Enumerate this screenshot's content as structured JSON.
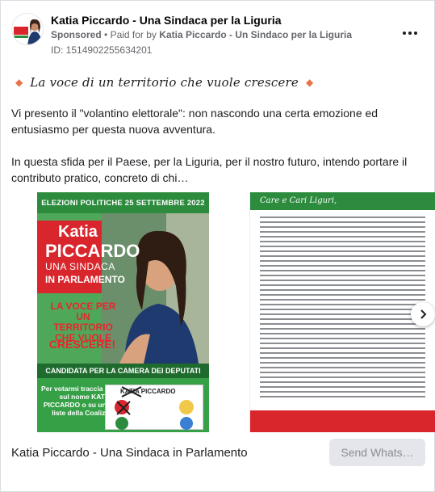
{
  "header": {
    "page_name": "Katia Piccardo - Una Sindaca per la Liguria",
    "sponsored": "Sponsored",
    "separator": "•",
    "paid_for_by_prefix": "Paid for by",
    "paid_for_by": "Katia Piccardo - Un Sindaco per la Liguria",
    "ad_id": "ID: 1514902255634201",
    "more_icon": "more-horizontal-icon"
  },
  "body": {
    "tagline": "La voce di un territorio che vuole crescere",
    "paragraph_1": "Vi presento il \"volantino elettorale\": non nascondo una certa emozione ed entusiasmo per questa nuova avventura.",
    "paragraph_2": "In questa sfida per il Paese, per la Liguria, per il nostro futuro, intendo portare il contributo pratico, concreto di chi…"
  },
  "carousel": {
    "slide_1": {
      "top_banner": "ELEZIONI POLITICHE 25 SETTEMBRE 2022",
      "first_name": "Katia",
      "last_name": "PICCARDO",
      "subtitle_1": "UNA SINDACA",
      "subtitle_2": "IN PARLAMENTO",
      "slogan": "LA VOCE PER UN TERRITORIO CHE VUOLE",
      "slogan_2": "CRESCERE!",
      "band": "CANDIDATA PER LA CAMERA DEI DEPUTATI",
      "vote_text": "Per votarmi traccia una \"X\" sul nome KATIA PICCARDO o su una delle liste della Coalizione",
      "ballot_name": "KATIA PICCARDO"
    },
    "slide_2": {
      "heading": "Care e Cari Liguri,"
    },
    "next_icon": "chevron-right-icon"
  },
  "footer": {
    "title": "Katia Piccardo - Una Sindaca in Parlamento",
    "cta": "Send Whats…"
  },
  "colors": {
    "accent_orange": "#e8734a",
    "poster_green": "#36a047",
    "poster_red": "#d9262c"
  }
}
